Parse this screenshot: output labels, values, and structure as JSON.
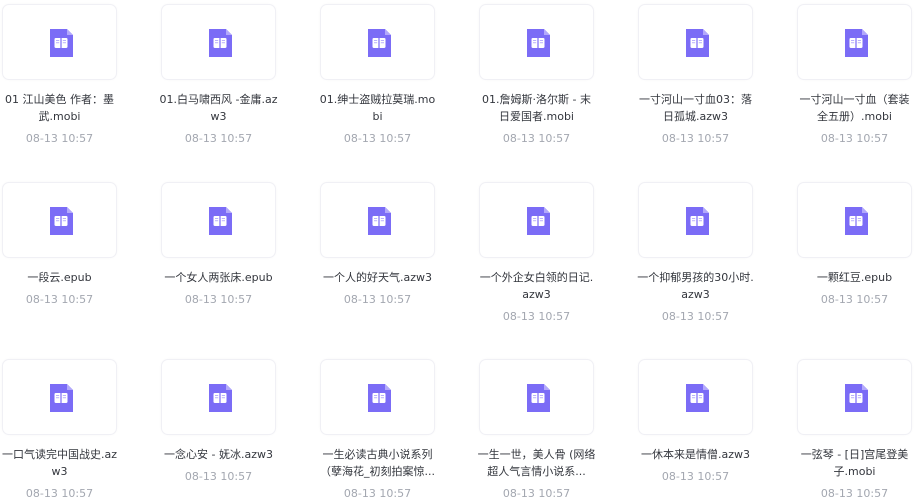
{
  "accent_icon_color": "#7b6cf6",
  "icon": "ebook-file-icon",
  "files": [
    {
      "name": "01 江山美色 作者：墨武.mobi",
      "date": "08-13 10:57"
    },
    {
      "name": "01.白马啸西风 -金庸.azw3",
      "date": "08-13 10:57"
    },
    {
      "name": "01.绅士盗贼拉莫瑞.mobi",
      "date": "08-13 10:57"
    },
    {
      "name": "01.詹姆斯·洛尔斯 - 末日爱国者.mobi",
      "date": "08-13 10:57"
    },
    {
      "name": "一寸河山一寸血03：落日孤城.azw3",
      "date": "08-13 10:57"
    },
    {
      "name": "一寸河山一寸血（套装全五册）.mobi",
      "date": "08-13 10:57"
    },
    {
      "name": "一段云.epub",
      "date": "08-13 10:57"
    },
    {
      "name": "一个女人两张床.epub",
      "date": "08-13 10:57"
    },
    {
      "name": "一个人的好天气.azw3",
      "date": "08-13 10:57"
    },
    {
      "name": "一个外企女白领的日记.azw3",
      "date": "08-13 10:57"
    },
    {
      "name": "一个抑郁男孩的30小时.azw3",
      "date": "08-13 10:57"
    },
    {
      "name": "一颗红豆.epub",
      "date": "08-13 10:57"
    },
    {
      "name": "一口气读完中国战史.azw3",
      "date": "08-13 10:57"
    },
    {
      "name": "一念心安 - 妩冰.azw3",
      "date": "08-13 10:57"
    },
    {
      "name": "一生必读古典小说系列（孽海花_初刻拍案惊...",
      "date": "08-13 10:57"
    },
    {
      "name": "一生一世，美人骨 (网络超人气言情小说系...",
      "date": "08-13 10:57"
    },
    {
      "name": "一休本来是情僧.azw3",
      "date": "08-13 10:57"
    },
    {
      "name": "一弦琴 - [日]宫尾登美子.mobi",
      "date": "08-13 10:57"
    }
  ]
}
